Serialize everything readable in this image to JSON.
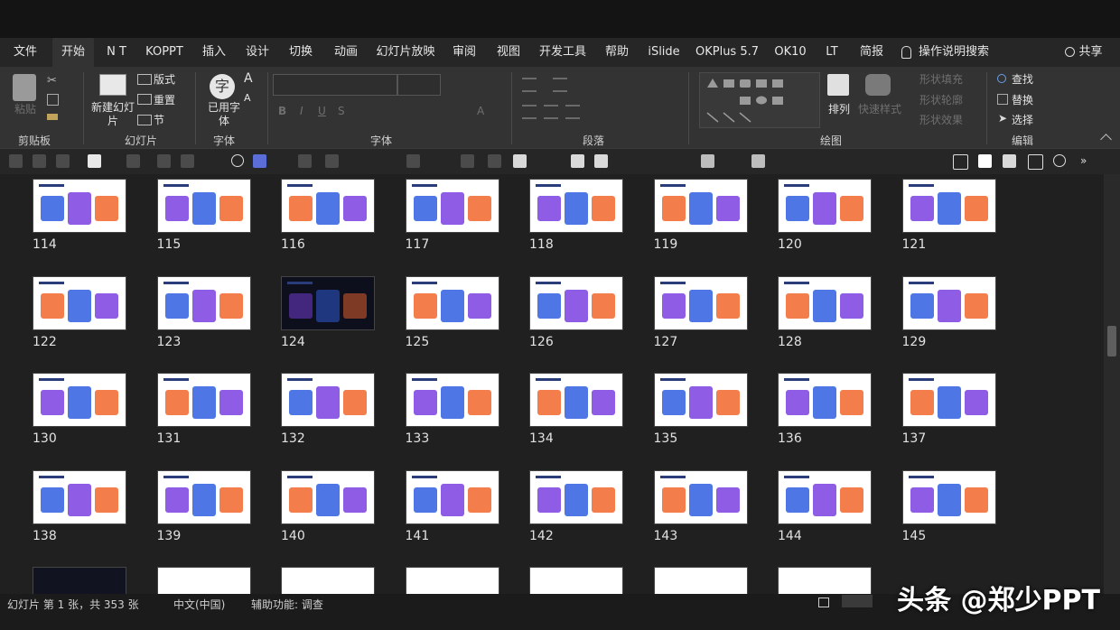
{
  "menu_tabs": [
    "文件",
    "开始",
    "N T",
    "KOPPT",
    "插入",
    "设计",
    "切换",
    "动画",
    "幻灯片放映",
    "审阅",
    "视图",
    "开发工具",
    "帮助",
    "iSlide",
    "OKPlus 5.7",
    "OK10",
    "LT",
    "简报"
  ],
  "tell_me": "操作说明搜索",
  "share": "共享",
  "ribbon": {
    "paste": "粘贴",
    "new_slide": "新建幻灯片",
    "layout": "版式",
    "reset": "重置",
    "section": "节",
    "font_char": "字",
    "common_font": "已用字体",
    "arrange": "排列",
    "quick_styles": "快速样式",
    "shape_fill": "形状填充",
    "shape_outline": "形状轮廓",
    "shape_effects": "形状效果",
    "find": "查找",
    "replace": "替换",
    "select": "选择",
    "groups": {
      "clipboard": "剪贴板",
      "slides": "幻灯片",
      "font_tool": "字体",
      "font": "字体",
      "paragraph": "段落",
      "drawing": "绘图",
      "editing": "编辑"
    }
  },
  "slides": [
    "114",
    "115",
    "116",
    "117",
    "118",
    "119",
    "120",
    "121",
    "122",
    "123",
    "124",
    "125",
    "126",
    "127",
    "128",
    "129",
    "130",
    "131",
    "132",
    "133",
    "134",
    "135",
    "136",
    "137",
    "138",
    "139",
    "140",
    "141",
    "142",
    "143",
    "144",
    "145"
  ],
  "status": {
    "slide_info": "幻灯片 第 1 张，共 353 张",
    "language": "中文(中国)",
    "accessibility": "辅助功能: 调查"
  },
  "watermark": "头条 @郑少PPT",
  "colors": {
    "accent_blue": "#2f5fe0",
    "accent_purple": "#7a3fe0",
    "accent_orange": "#f2662d"
  }
}
